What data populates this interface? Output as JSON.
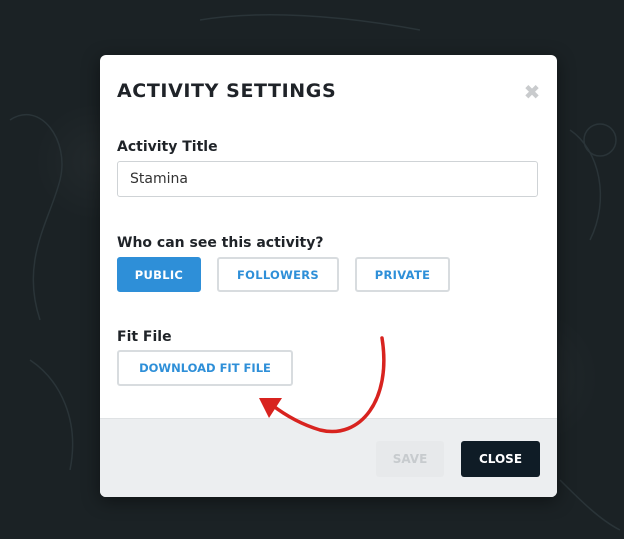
{
  "dialog": {
    "title": "ACTIVITY SETTINGS",
    "close_icon": "close-icon"
  },
  "activity_title": {
    "label": "Activity Title",
    "value": "Stamina",
    "placeholder": ""
  },
  "visibility": {
    "label": "Who can see this activity?",
    "options": [
      "PUBLIC",
      "FOLLOWERS",
      "PRIVATE"
    ],
    "selected": "PUBLIC"
  },
  "fit_file": {
    "label": "Fit File",
    "download_label": "DOWNLOAD FIT FILE"
  },
  "footer": {
    "save_label": "SAVE",
    "close_label": "CLOSE"
  },
  "colors": {
    "accent": "#2e8fd8",
    "dark": "#0f1c26",
    "annotation_arrow": "#d8231f"
  }
}
